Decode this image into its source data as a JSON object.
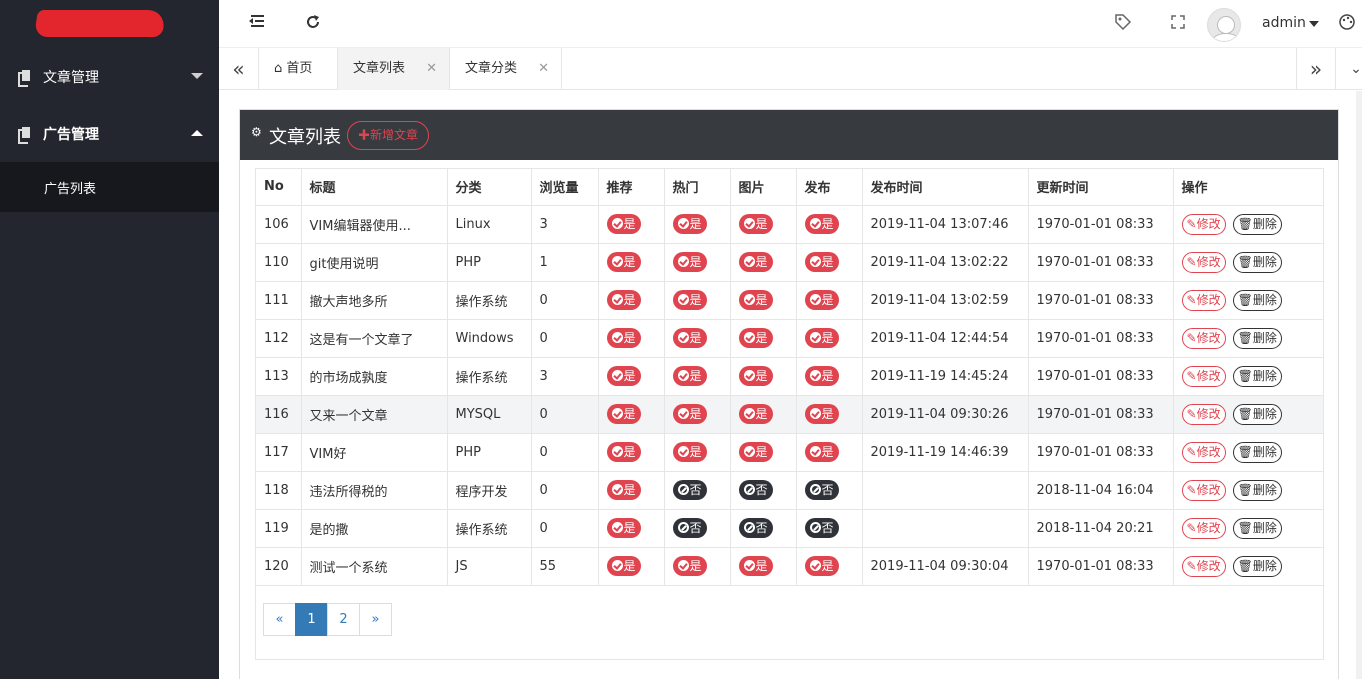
{
  "sidebar": {
    "items": [
      {
        "label": "文章管理",
        "expanded": false
      },
      {
        "label": "广告管理",
        "expanded": true
      }
    ],
    "subitems": [
      {
        "label": "广告列表"
      }
    ]
  },
  "header": {
    "user": "admin"
  },
  "tabs": [
    {
      "label": "首页"
    },
    {
      "label": "文章列表"
    },
    {
      "label": "文章分类"
    }
  ],
  "panel": {
    "title": "文章列表",
    "add_label": "新增文章"
  },
  "table": {
    "headers": [
      "No",
      "标题",
      "分类",
      "浏览量",
      "推荐",
      "热门",
      "图片",
      "发布",
      "发布时间",
      "更新时间",
      "操作"
    ],
    "yes_label": "是",
    "no_label": "否",
    "edit_label": "修改",
    "delete_label": "删除",
    "rows": [
      {
        "no": "106",
        "title": "VIM编辑器使用...",
        "category": "Linux",
        "views": "3",
        "recommend": true,
        "hot": true,
        "image": true,
        "publish": true,
        "pub_time": "2019-11-04 13:07:46",
        "upd_time": "1970-01-01 08:33"
      },
      {
        "no": "110",
        "title": "git使用说明",
        "category": "PHP",
        "views": "1",
        "recommend": true,
        "hot": true,
        "image": true,
        "publish": true,
        "pub_time": "2019-11-04 13:02:22",
        "upd_time": "1970-01-01 08:33"
      },
      {
        "no": "111",
        "title": "撤大声地多所",
        "category": "操作系统",
        "views": "0",
        "recommend": true,
        "hot": true,
        "image": true,
        "publish": true,
        "pub_time": "2019-11-04 13:02:59",
        "upd_time": "1970-01-01 08:33"
      },
      {
        "no": "112",
        "title": "这是有一个文章了",
        "category": "Windows",
        "views": "0",
        "recommend": true,
        "hot": true,
        "image": true,
        "publish": true,
        "pub_time": "2019-11-04 12:44:54",
        "upd_time": "1970-01-01 08:33"
      },
      {
        "no": "113",
        "title": "的市场成孰度",
        "category": "操作系统",
        "views": "3",
        "recommend": true,
        "hot": true,
        "image": true,
        "publish": true,
        "pub_time": "2019-11-19 14:45:24",
        "upd_time": "1970-01-01 08:33"
      },
      {
        "no": "116",
        "title": "又来一个文章",
        "category": "MYSQL",
        "views": "0",
        "recommend": true,
        "hot": true,
        "image": true,
        "publish": true,
        "pub_time": "2019-11-04 09:30:26",
        "upd_time": "1970-01-01 08:33"
      },
      {
        "no": "117",
        "title": "VIM好",
        "category": "PHP",
        "views": "0",
        "recommend": true,
        "hot": true,
        "image": true,
        "publish": true,
        "pub_time": "2019-11-19 14:46:39",
        "upd_time": "1970-01-01 08:33"
      },
      {
        "no": "118",
        "title": "违法所得税的",
        "category": "程序开发",
        "views": "0",
        "recommend": true,
        "hot": false,
        "image": false,
        "publish": false,
        "pub_time": "",
        "upd_time": "2018-11-04 16:04"
      },
      {
        "no": "119",
        "title": "是的撒",
        "category": "操作系统",
        "views": "0",
        "recommend": true,
        "hot": false,
        "image": false,
        "publish": false,
        "pub_time": "",
        "upd_time": "2018-11-04 20:21"
      },
      {
        "no": "120",
        "title": "测试一个系统",
        "category": "JS",
        "views": "55",
        "recommend": true,
        "hot": true,
        "image": true,
        "publish": true,
        "pub_time": "2019-11-04 09:30:04",
        "upd_time": "1970-01-01 08:33"
      }
    ]
  },
  "pagination": {
    "prev": "«",
    "pages": [
      "1",
      "2"
    ],
    "current": "1",
    "next": "»"
  },
  "colors": {
    "sidebar_bg": "#23262e",
    "accent_red": "#e0444f",
    "panel_head": "#373a3f",
    "page_active": "#337ab7"
  }
}
